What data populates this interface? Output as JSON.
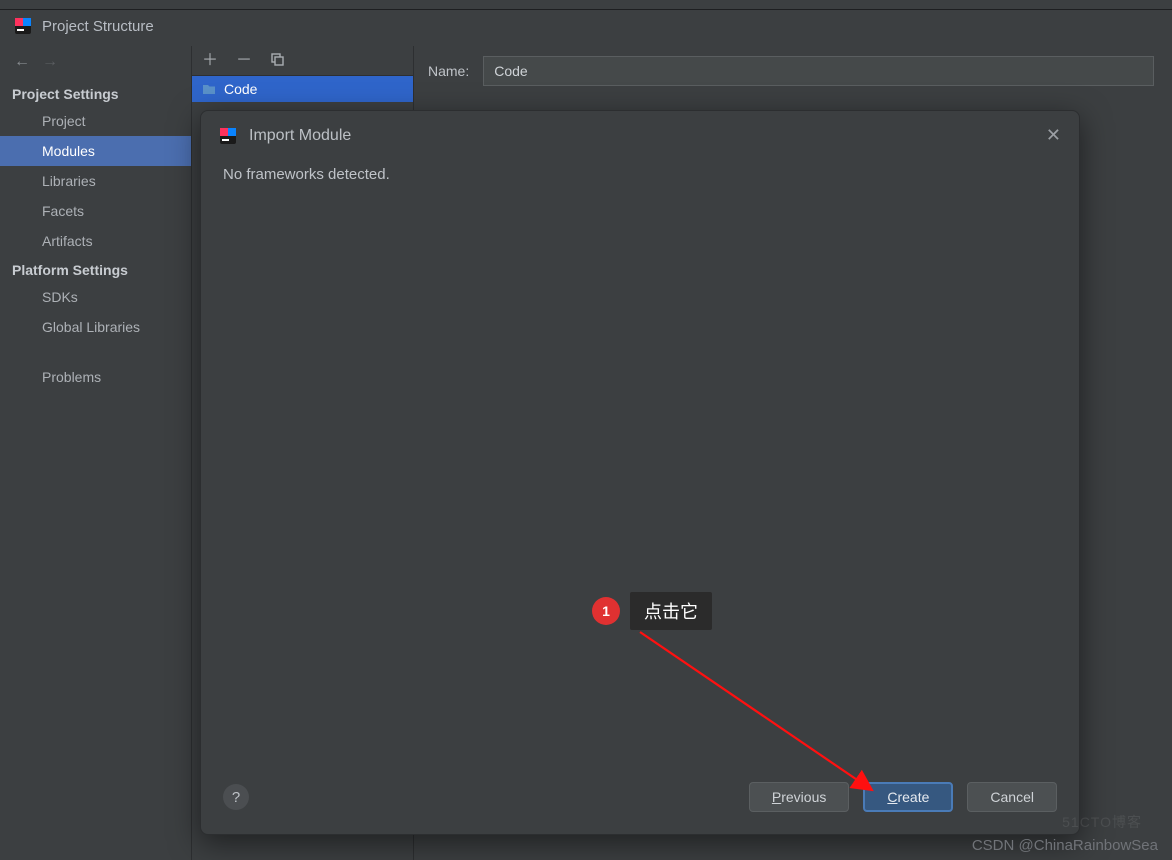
{
  "window": {
    "title": "Project Structure"
  },
  "nav": {
    "back_enabled": true,
    "forward_enabled": false
  },
  "sidebar": {
    "section1_title": "Project Settings",
    "section1_items": [
      {
        "label": "Project"
      },
      {
        "label": "Modules"
      },
      {
        "label": "Libraries"
      },
      {
        "label": "Facets"
      },
      {
        "label": "Artifacts"
      }
    ],
    "section1_selected": "Modules",
    "section2_title": "Platform Settings",
    "section2_items": [
      {
        "label": "SDKs"
      },
      {
        "label": "Global Libraries"
      }
    ],
    "section3_items": [
      {
        "label": "Problems"
      }
    ]
  },
  "modules": {
    "items": [
      {
        "label": "Code"
      }
    ],
    "selected": "Code"
  },
  "name_field": {
    "label": "Name:",
    "value": "Code"
  },
  "dialog": {
    "title": "Import Module",
    "body_text": "No frameworks detected.",
    "help": "?",
    "buttons": {
      "previous": "Previous",
      "create": "Create",
      "cancel": "Cancel"
    }
  },
  "annotation": {
    "number": "1",
    "label": "点击它"
  },
  "watermark": "CSDN @ChinaRainbowSea",
  "watermark2": "51CTO博客"
}
